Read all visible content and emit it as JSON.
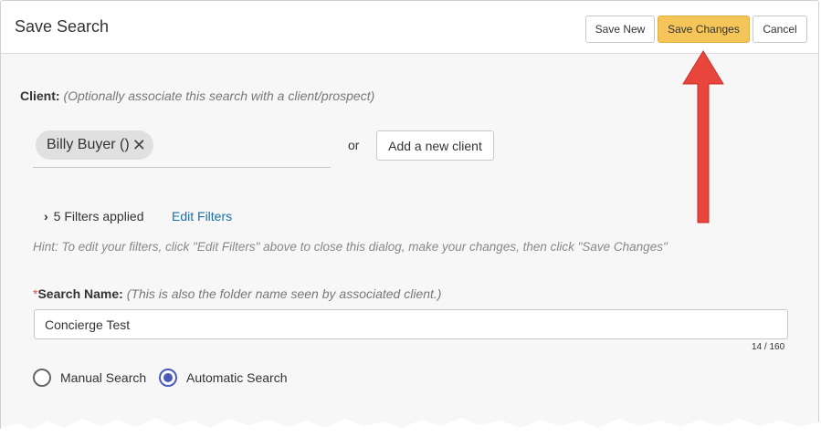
{
  "dialog": {
    "title": "Save Search",
    "buttons": {
      "save_new": "Save New",
      "save_changes": "Save Changes",
      "cancel": "Cancel"
    }
  },
  "client": {
    "label": "Client:",
    "hint": "(Optionally associate this search with a client/prospect)",
    "chip": "Billy Buyer ()",
    "remove_icon": "close-icon",
    "or": "or",
    "add_button": "Add a new client"
  },
  "filters": {
    "summary": "5 Filters applied",
    "edit_link": "Edit Filters",
    "hint": "Hint: To edit your filters, click \"Edit Filters\" above to close this dialog, make your changes, then click \"Save Changes\""
  },
  "search_name": {
    "required_mark": "*",
    "label": "Search Name:",
    "hint": "(This is also the folder name seen by associated client.)",
    "value": "Concierge Test",
    "counter": "14 / 160"
  },
  "search_type": {
    "options": [
      "Manual Search",
      "Automatic Search"
    ],
    "selected": "Automatic Search"
  },
  "colors": {
    "accent_button": "#f5c55a",
    "link": "#1a6fa8",
    "radio_selected": "#4a5aba",
    "annotation_arrow": "#e8453c"
  }
}
